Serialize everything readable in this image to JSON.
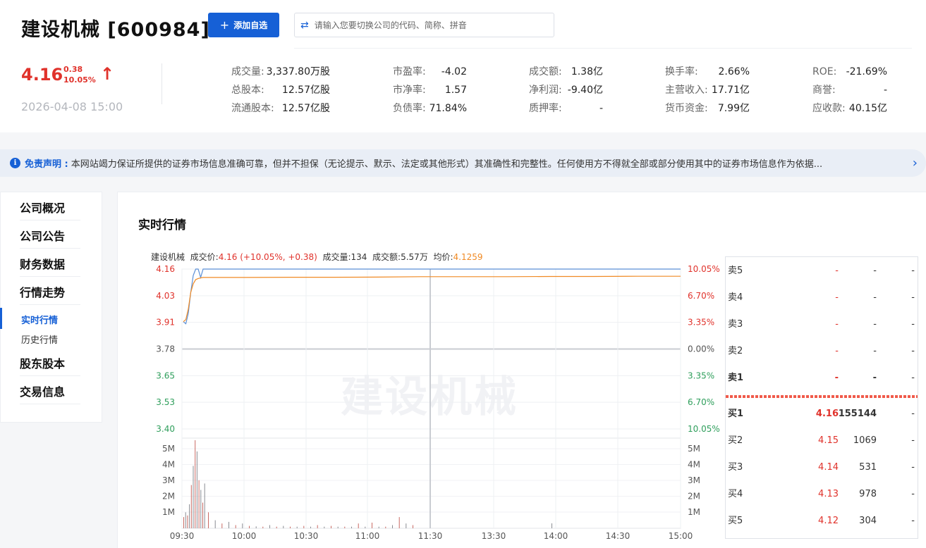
{
  "header": {
    "title": "建设机械 [600984]",
    "add_button": "添加自选",
    "search_placeholder": "请输入您要切换公司的代码、简称、拼音",
    "price": "4.16",
    "change": "0.38",
    "change_pct": "10.05%",
    "datetime": "2026-04-08 15:00"
  },
  "stats": [
    [
      {
        "k": "成交量:",
        "v": "3,337.80万股"
      },
      {
        "k": "总股本:",
        "v": "12.57亿股"
      },
      {
        "k": "流通股本:",
        "v": "12.57亿股"
      }
    ],
    [
      {
        "k": "市盈率:",
        "v": "-4.02"
      },
      {
        "k": "市净率:",
        "v": "1.57"
      },
      {
        "k": "负债率:",
        "v": "71.84%"
      }
    ],
    [
      {
        "k": "成交额:",
        "v": "1.38亿"
      },
      {
        "k": "净利润:",
        "v": "-9.40亿"
      },
      {
        "k": "质押率:",
        "v": "-"
      }
    ],
    [
      {
        "k": "换手率:",
        "v": "2.66%"
      },
      {
        "k": "主营收入:",
        "v": "17.71亿"
      },
      {
        "k": "货币资金:",
        "v": "7.99亿"
      }
    ],
    [
      {
        "k": "ROE:",
        "v": "-21.69%"
      },
      {
        "k": "商誉:",
        "v": "-"
      },
      {
        "k": "应收款:",
        "v": "40.15亿"
      }
    ]
  ],
  "notice": {
    "label": "免责声明 :",
    "text": "本网站竭力保证所提供的证券市场信息准确可靠，但并不担保（无论提示、默示、法定或其他形式）其准确性和完整性。任何使用方不得就全部或部分使用其中的证券市场信息作为依据..."
  },
  "sidebar": {
    "items": [
      "公司概况",
      "公司公告",
      "财务数据",
      "行情走势"
    ],
    "subitems": [
      "实时行情",
      "历史行情"
    ],
    "items2": [
      "股东股本",
      "交易信息"
    ]
  },
  "main": {
    "title": "实时行情",
    "chart_info": {
      "name": "建设机械",
      "price_label": "成交价:",
      "price_value": "4.16 (+10.05%, +0.38)",
      "vol_label": "成交量:",
      "vol_value": "134",
      "amt_label": "成交额:",
      "amt_value": "5.57万",
      "avg_label": "均价:",
      "avg_value": "4.1259"
    },
    "watermark": "建设机械"
  },
  "chart_data": {
    "type": "line",
    "y_left_ticks": [
      "4.16",
      "4.03",
      "3.91",
      "3.78",
      "3.65",
      "3.53",
      "3.40"
    ],
    "y_right_ticks": [
      "10.05%",
      "6.70%",
      "3.35%",
      "0.00%",
      "3.35%",
      "6.70%",
      "10.05%"
    ],
    "vol_ticks": [
      "5M",
      "4M",
      "3M",
      "2M",
      "1M"
    ],
    "x_ticks": [
      "09:30",
      "10:00",
      "10:30",
      "11:00",
      "11:30",
      "13:30",
      "14:00",
      "14:30",
      "15:00"
    ],
    "ylim": [
      3.4,
      4.16
    ],
    "series": [
      {
        "name": "成交价",
        "color": "#5b8fd6",
        "values": [
          3.91,
          3.9,
          3.95,
          4.05,
          4.13,
          4.16,
          4.16,
          4.12,
          4.16,
          4.16,
          4.16,
          4.16,
          4.16,
          4.16,
          4.16,
          4.16,
          4.16,
          4.16,
          4.16,
          4.16
        ]
      },
      {
        "name": "均价",
        "color": "#f08a24",
        "values": [
          3.91,
          3.92,
          3.97,
          4.05,
          4.09,
          4.11,
          4.115,
          4.118,
          4.12,
          4.12,
          4.121,
          4.121,
          4.122,
          4.124,
          4.124,
          4.124,
          4.125,
          4.125,
          4.1259,
          4.1259
        ]
      }
    ],
    "volume_m": [
      0.7,
      1.0,
      0.8,
      1.5,
      2.7,
      3.9,
      5.5,
      4.8,
      3.0,
      2.4,
      1.6,
      2.8,
      1.0,
      0.5,
      0.3,
      0.4,
      0.2,
      0.3,
      0.15,
      0.12,
      0.1,
      0.2,
      0.1,
      0.15,
      0.1,
      0.1,
      0.15,
      0.1,
      0.2,
      0.1,
      0.15,
      0.1,
      0.1,
      0.1,
      0.3,
      0.1,
      0.35,
      0.1,
      0.1,
      0.2,
      0.7,
      0.3,
      0.2
    ]
  },
  "orderbook": {
    "sell": [
      {
        "label": "卖5",
        "price": "-",
        "vol": "-",
        "ext": "-"
      },
      {
        "label": "卖4",
        "price": "-",
        "vol": "-",
        "ext": "-"
      },
      {
        "label": "卖3",
        "price": "-",
        "vol": "-",
        "ext": "-"
      },
      {
        "label": "卖2",
        "price": "-",
        "vol": "-",
        "ext": "-"
      },
      {
        "label": "卖1",
        "price": "-",
        "vol": "-",
        "ext": "-"
      }
    ],
    "buy": [
      {
        "label": "买1",
        "price": "4.16",
        "vol": "155144",
        "ext": "-"
      },
      {
        "label": "买2",
        "price": "4.15",
        "vol": "1069",
        "ext": "-"
      },
      {
        "label": "买3",
        "price": "4.14",
        "vol": "531",
        "ext": "-"
      },
      {
        "label": "买4",
        "price": "4.13",
        "vol": "978",
        "ext": "-"
      },
      {
        "label": "买5",
        "price": "4.12",
        "vol": "304",
        "ext": "-"
      }
    ]
  },
  "colors": {
    "accent": "#1660d6",
    "up": "#e0322b",
    "down": "#2e9e5b",
    "avg": "#f08a24"
  }
}
